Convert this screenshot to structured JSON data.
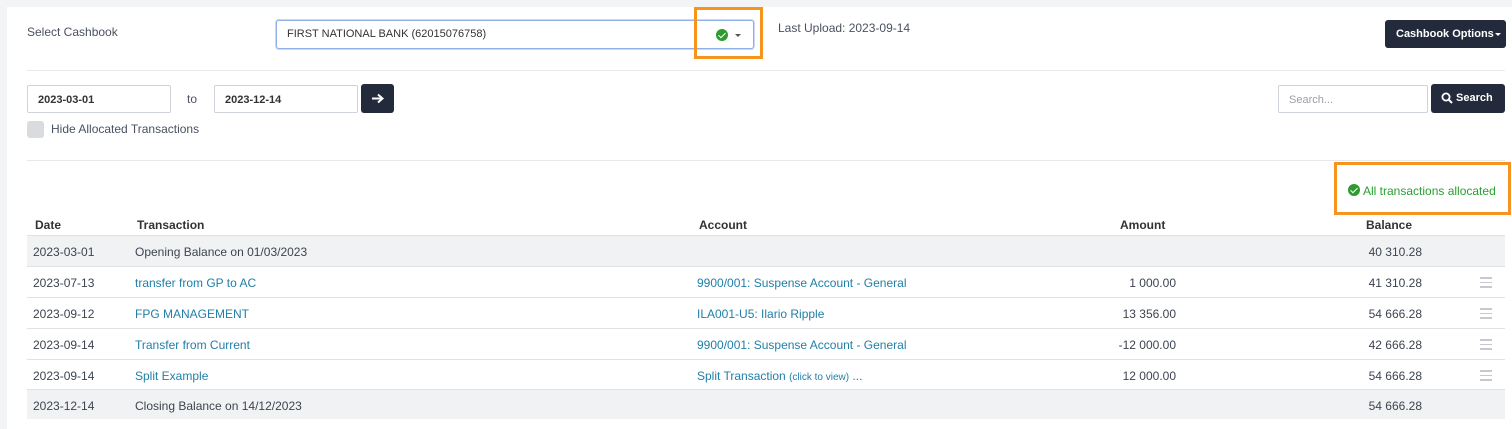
{
  "cashbook": {
    "label": "Select Cashbook",
    "selected": "FIRST NATIONAL BANK (62015076758)",
    "last_upload": "Last Upload: 2023-09-14",
    "options_button": "Cashbook Options"
  },
  "filters": {
    "from_date": "2023-03-01",
    "to_label": "to",
    "to_date": "2023-12-14",
    "hide_allocated_label": "Hide Allocated Transactions",
    "search_placeholder": "Search...",
    "search_button": "Search"
  },
  "status": {
    "allocated_text": "All transactions allocated",
    "color": "#27a12f"
  },
  "table": {
    "headers": {
      "date": "Date",
      "transaction": "Transaction",
      "account": "Account",
      "amount": "Amount",
      "balance": "Balance"
    },
    "rows": [
      {
        "date": "2023-03-01",
        "transaction": "Opening Balance on 01/03/2023",
        "account": "",
        "amount": "",
        "balance": "40 310.28"
      },
      {
        "date": "2023-07-13",
        "transaction": "transfer from GP to AC",
        "account": "9900/001: Suspense Account - General",
        "amount": "1 000.00",
        "balance": "41 310.28"
      },
      {
        "date": "2023-09-12",
        "transaction": "FPG MANAGEMENT",
        "account": "ILA001-U5: Ilario Ripple",
        "amount": "13 356.00",
        "balance": "54 666.28"
      },
      {
        "date": "2023-09-14",
        "transaction": "Transfer from Current",
        "account": "9900/001: Suspense Account - General",
        "amount": "-12 000.00",
        "balance": "42 666.28"
      },
      {
        "date": "2023-09-14",
        "transaction": "Split Example",
        "account": "Split Transaction",
        "account_extra": "(click to view)",
        "account_suffix": " ...",
        "amount": "12 000.00",
        "balance": "54 666.28"
      },
      {
        "date": "2023-12-14",
        "transaction": "Closing Balance on 14/12/2023",
        "account": "",
        "amount": "",
        "balance": "54 666.28"
      }
    ]
  },
  "colors": {
    "highlight": "#f7941d",
    "button_dark": "#232a3b",
    "link": "#1f7fa8",
    "success": "#2e9b30"
  }
}
